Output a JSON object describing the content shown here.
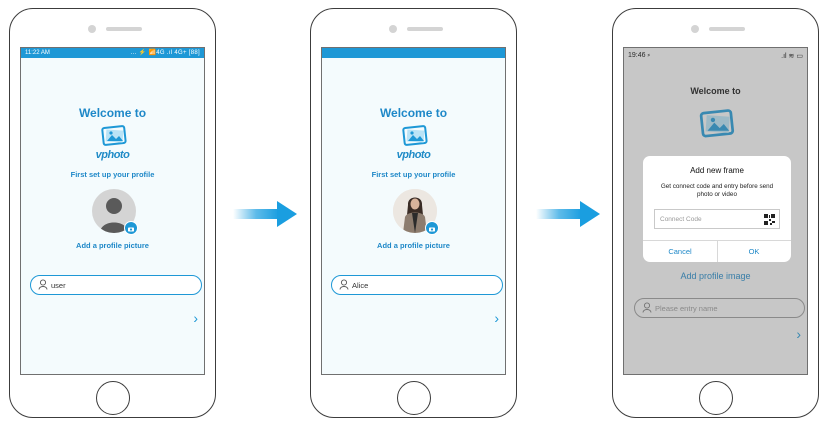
{
  "phone1": {
    "status_time": "11:22 AM",
    "status_icons": "... ⚡ 📶4G .ıl 4G+ [88]",
    "welcome": "Welcome to",
    "brand": "vphoto",
    "subtitle": "First set up your profile",
    "add_picture": "Add a profile picture",
    "name_value": "user"
  },
  "phone2": {
    "welcome": "Welcome to",
    "brand": "vphoto",
    "subtitle": "First set up your profile",
    "add_picture": "Add a profile picture",
    "name_value": "Alice"
  },
  "phone3": {
    "status_time": "19:46 ⸗",
    "status_icons": ".ıl ≋ ▭",
    "welcome": "Welcome to",
    "dialog": {
      "title": "Add new frame",
      "message": "Get connect code and entry before send photo or video",
      "input_placeholder": "Connect Code",
      "cancel": "Cancel",
      "ok": "OK"
    },
    "add_profile_image": "Add profile image",
    "name_placeholder": "Please entry name"
  },
  "colors": {
    "accent": "#1e98d6",
    "text_accent": "#1e88c8",
    "arrow": "#1a9ee0"
  }
}
